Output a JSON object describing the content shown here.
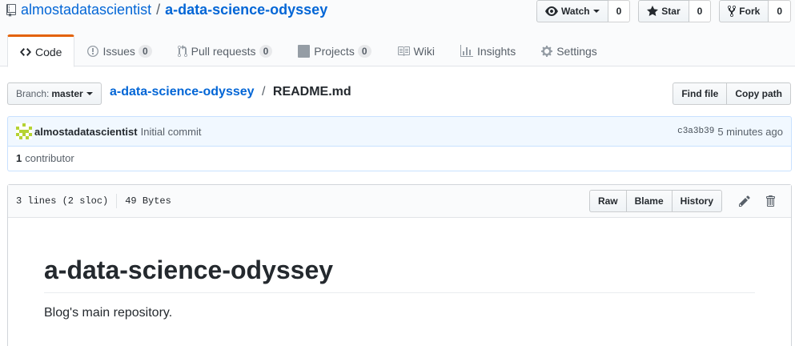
{
  "repo": {
    "owner": "almostadatascientist",
    "separator": "/",
    "name": "a-data-science-odyssey"
  },
  "actions": {
    "watch": {
      "label": "Watch",
      "count": "0"
    },
    "star": {
      "label": "Star",
      "count": "0"
    },
    "fork": {
      "label": "Fork",
      "count": "0"
    }
  },
  "nav": {
    "code": {
      "label": "Code"
    },
    "issues": {
      "label": "Issues",
      "count": "0"
    },
    "pulls": {
      "label": "Pull requests",
      "count": "0"
    },
    "projects": {
      "label": "Projects",
      "count": "0"
    },
    "wiki": {
      "label": "Wiki"
    },
    "insights": {
      "label": "Insights"
    },
    "settings": {
      "label": "Settings"
    }
  },
  "filenav": {
    "branch_prefix": "Branch:",
    "branch": "master",
    "crumb_repo": "a-data-science-odyssey",
    "crumb_sep": "/",
    "crumb_file": "README.md",
    "find_file": "Find file",
    "copy_path": "Copy path"
  },
  "commit": {
    "author": "almostadatascientist",
    "message": "Initial commit",
    "sha": "c3a3b39",
    "time": "5 minutes ago",
    "contributors_count": "1",
    "contributors_label": "contributor"
  },
  "file": {
    "lines": "3 lines (2 sloc)",
    "size": "49 Bytes",
    "raw": "Raw",
    "blame": "Blame",
    "history": "History"
  },
  "readme": {
    "heading": "a-data-science-odyssey",
    "paragraph": "Blog's main repository."
  },
  "colors": {
    "link": "#0366d6",
    "nav_accent": "#e36209",
    "commit_bg": "#f1f8ff",
    "avatar": "#b5d334"
  }
}
